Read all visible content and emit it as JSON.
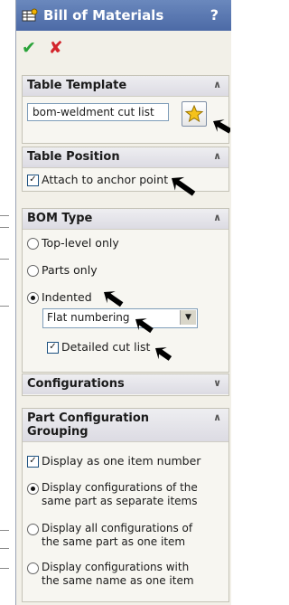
{
  "window": {
    "title": "Bill of Materials",
    "help": "?"
  },
  "actions": {
    "ok": "✔",
    "cancel": "✘"
  },
  "table_template": {
    "header": "Table Template",
    "value": "bom-weldment cut list"
  },
  "table_position": {
    "header": "Table Position",
    "attach_label": "Attach to anchor point",
    "attach_checked": true
  },
  "bom_type": {
    "header": "BOM Type",
    "options": [
      "Top-level only",
      "Parts only",
      "Indented"
    ],
    "selected": "Indented",
    "numbering": "Flat numbering",
    "detailed_label": "Detailed cut list",
    "detailed_checked": true
  },
  "configurations": {
    "header": "Configurations"
  },
  "part_grouping": {
    "header_line1": "Part Configuration",
    "header_line2": "Grouping",
    "display_one_label": "Display as one item number",
    "options": [
      {
        "line1": "Display configurations of the",
        "line2": "same part as separate items"
      },
      {
        "line1": "Display all configurations of",
        "line2": "the same part as one item"
      },
      {
        "line1": "Display configurations with",
        "line2": "the same name as one item"
      }
    ]
  },
  "colors": {
    "title_bar": "#5577b2",
    "ok": "#2aa339",
    "cancel": "#d3242b",
    "panel_bg": "#f2f0e8",
    "arrows": "#000000"
  }
}
